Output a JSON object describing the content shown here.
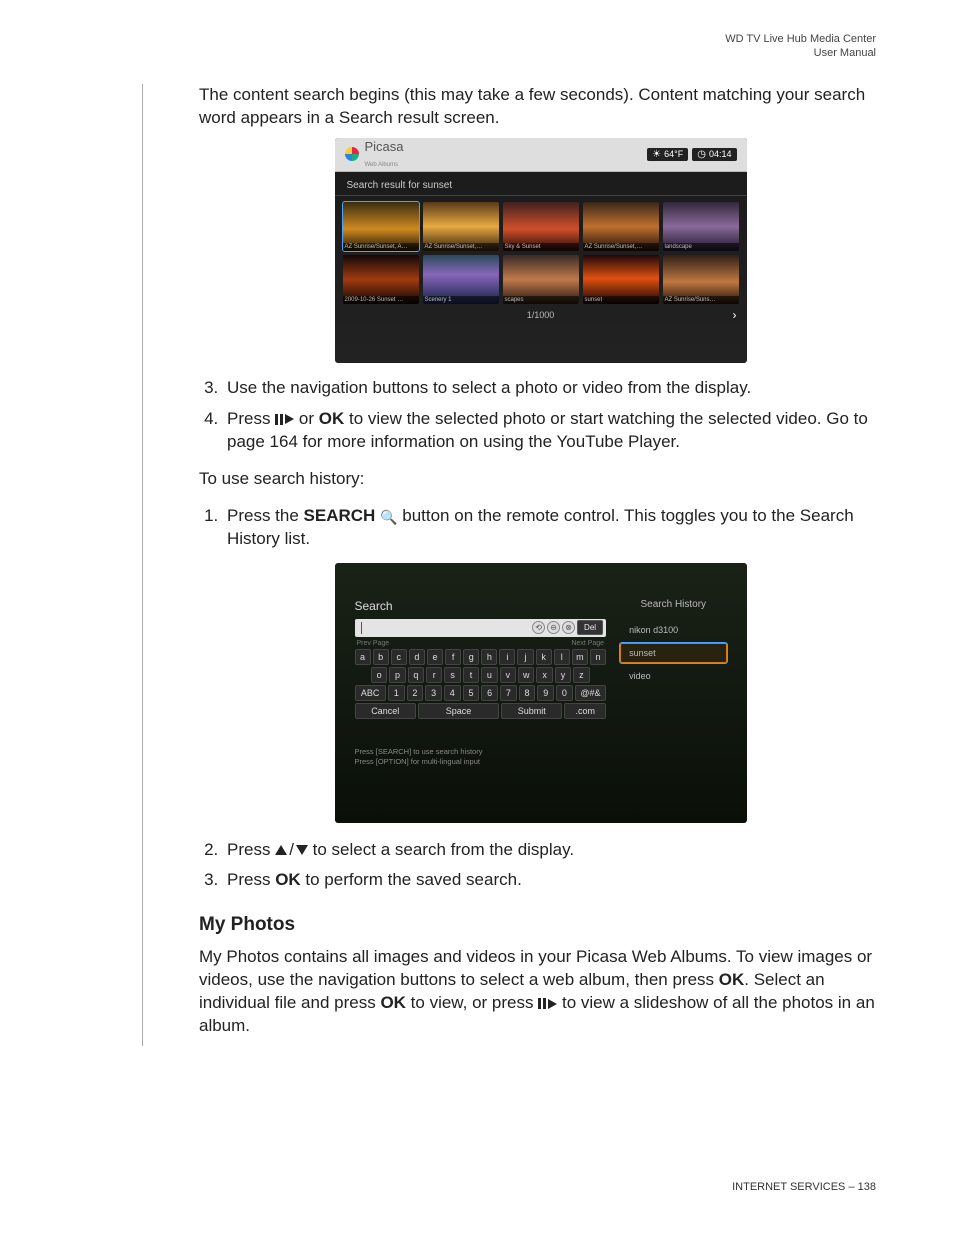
{
  "header": {
    "l1": "WD TV Live Hub Media Center",
    "l2": "User Manual"
  },
  "intro": "The content search begins (this may take a few seconds). Content matching your search word appears in a Search result screen.",
  "shot1": {
    "brand": "Picasa",
    "brand_sub": "Web Albums",
    "temp": "64°F",
    "time": "04:14",
    "title": "Search result for sunset",
    "pager": "1/1000",
    "thumbs": [
      "AZ Sunrise/Sunset, A…",
      "AZ Sunrise/Sunset,…",
      "Sky & Sunset",
      "AZ Sunrise/Sunset,…",
      "landscape",
      "2009-10-26 Sunset …",
      "Scenery 1",
      "scapes",
      "sunset",
      "AZ Sunrise/Suns…"
    ]
  },
  "step3": "Use the navigation buttons to select a photo or video from the display.",
  "step4a": "Press ",
  "step4b": " or ",
  "step4ok": "OK",
  "step4c": " to view the selected photo or start watching the selected video. Go to page 164 for more information on using the YouTube Player.",
  "histHeader": "To use search history:",
  "h1a": "Press the ",
  "h1search": "SEARCH",
  "h1b": " button on the remote control. This toggles you to the Search History list.",
  "shot2": {
    "title": "Search",
    "del": "Del",
    "prev": "Prev Page",
    "next": "Next Page",
    "row1": [
      "a",
      "b",
      "c",
      "d",
      "e",
      "f",
      "g",
      "h",
      "i",
      "j",
      "k",
      "l",
      "m",
      "n"
    ],
    "row2": [
      "o",
      "p",
      "q",
      "r",
      "s",
      "t",
      "u",
      "v",
      "w",
      "x",
      "y",
      "z"
    ],
    "row3": [
      "ABC",
      "1",
      "2",
      "3",
      "4",
      "5",
      "6",
      "7",
      "8",
      "9",
      "0",
      "@#&"
    ],
    "row4": [
      "Cancel",
      "Space",
      "Submit",
      ".com"
    ],
    "sh_title": "Search History",
    "history": [
      "nikon d3100",
      "sunset",
      "video"
    ],
    "hint1": "Press [SEARCH] to use search history",
    "hint2": "Press [OPTION] for multi-lingual input"
  },
  "h2a": "Press ",
  "h2b": " to select a search from the display.",
  "h3a": "Press ",
  "h3ok": "OK",
  "h3b": " to perform the saved search.",
  "section": "My Photos",
  "mp_a": "My Photos contains all images and videos in your Picasa Web Albums. To view images or videos, use the navigation buttons to select a web album, then press ",
  "mp_ok1": "OK",
  "mp_b": ". Select an individual file and press ",
  "mp_ok2": "OK",
  "mp_c": " to view, or press ",
  "mp_d": " to view a slideshow of all the photos in an album.",
  "footer": {
    "section": "INTERNET SERVICES",
    "sep": " – ",
    "page": "138"
  }
}
